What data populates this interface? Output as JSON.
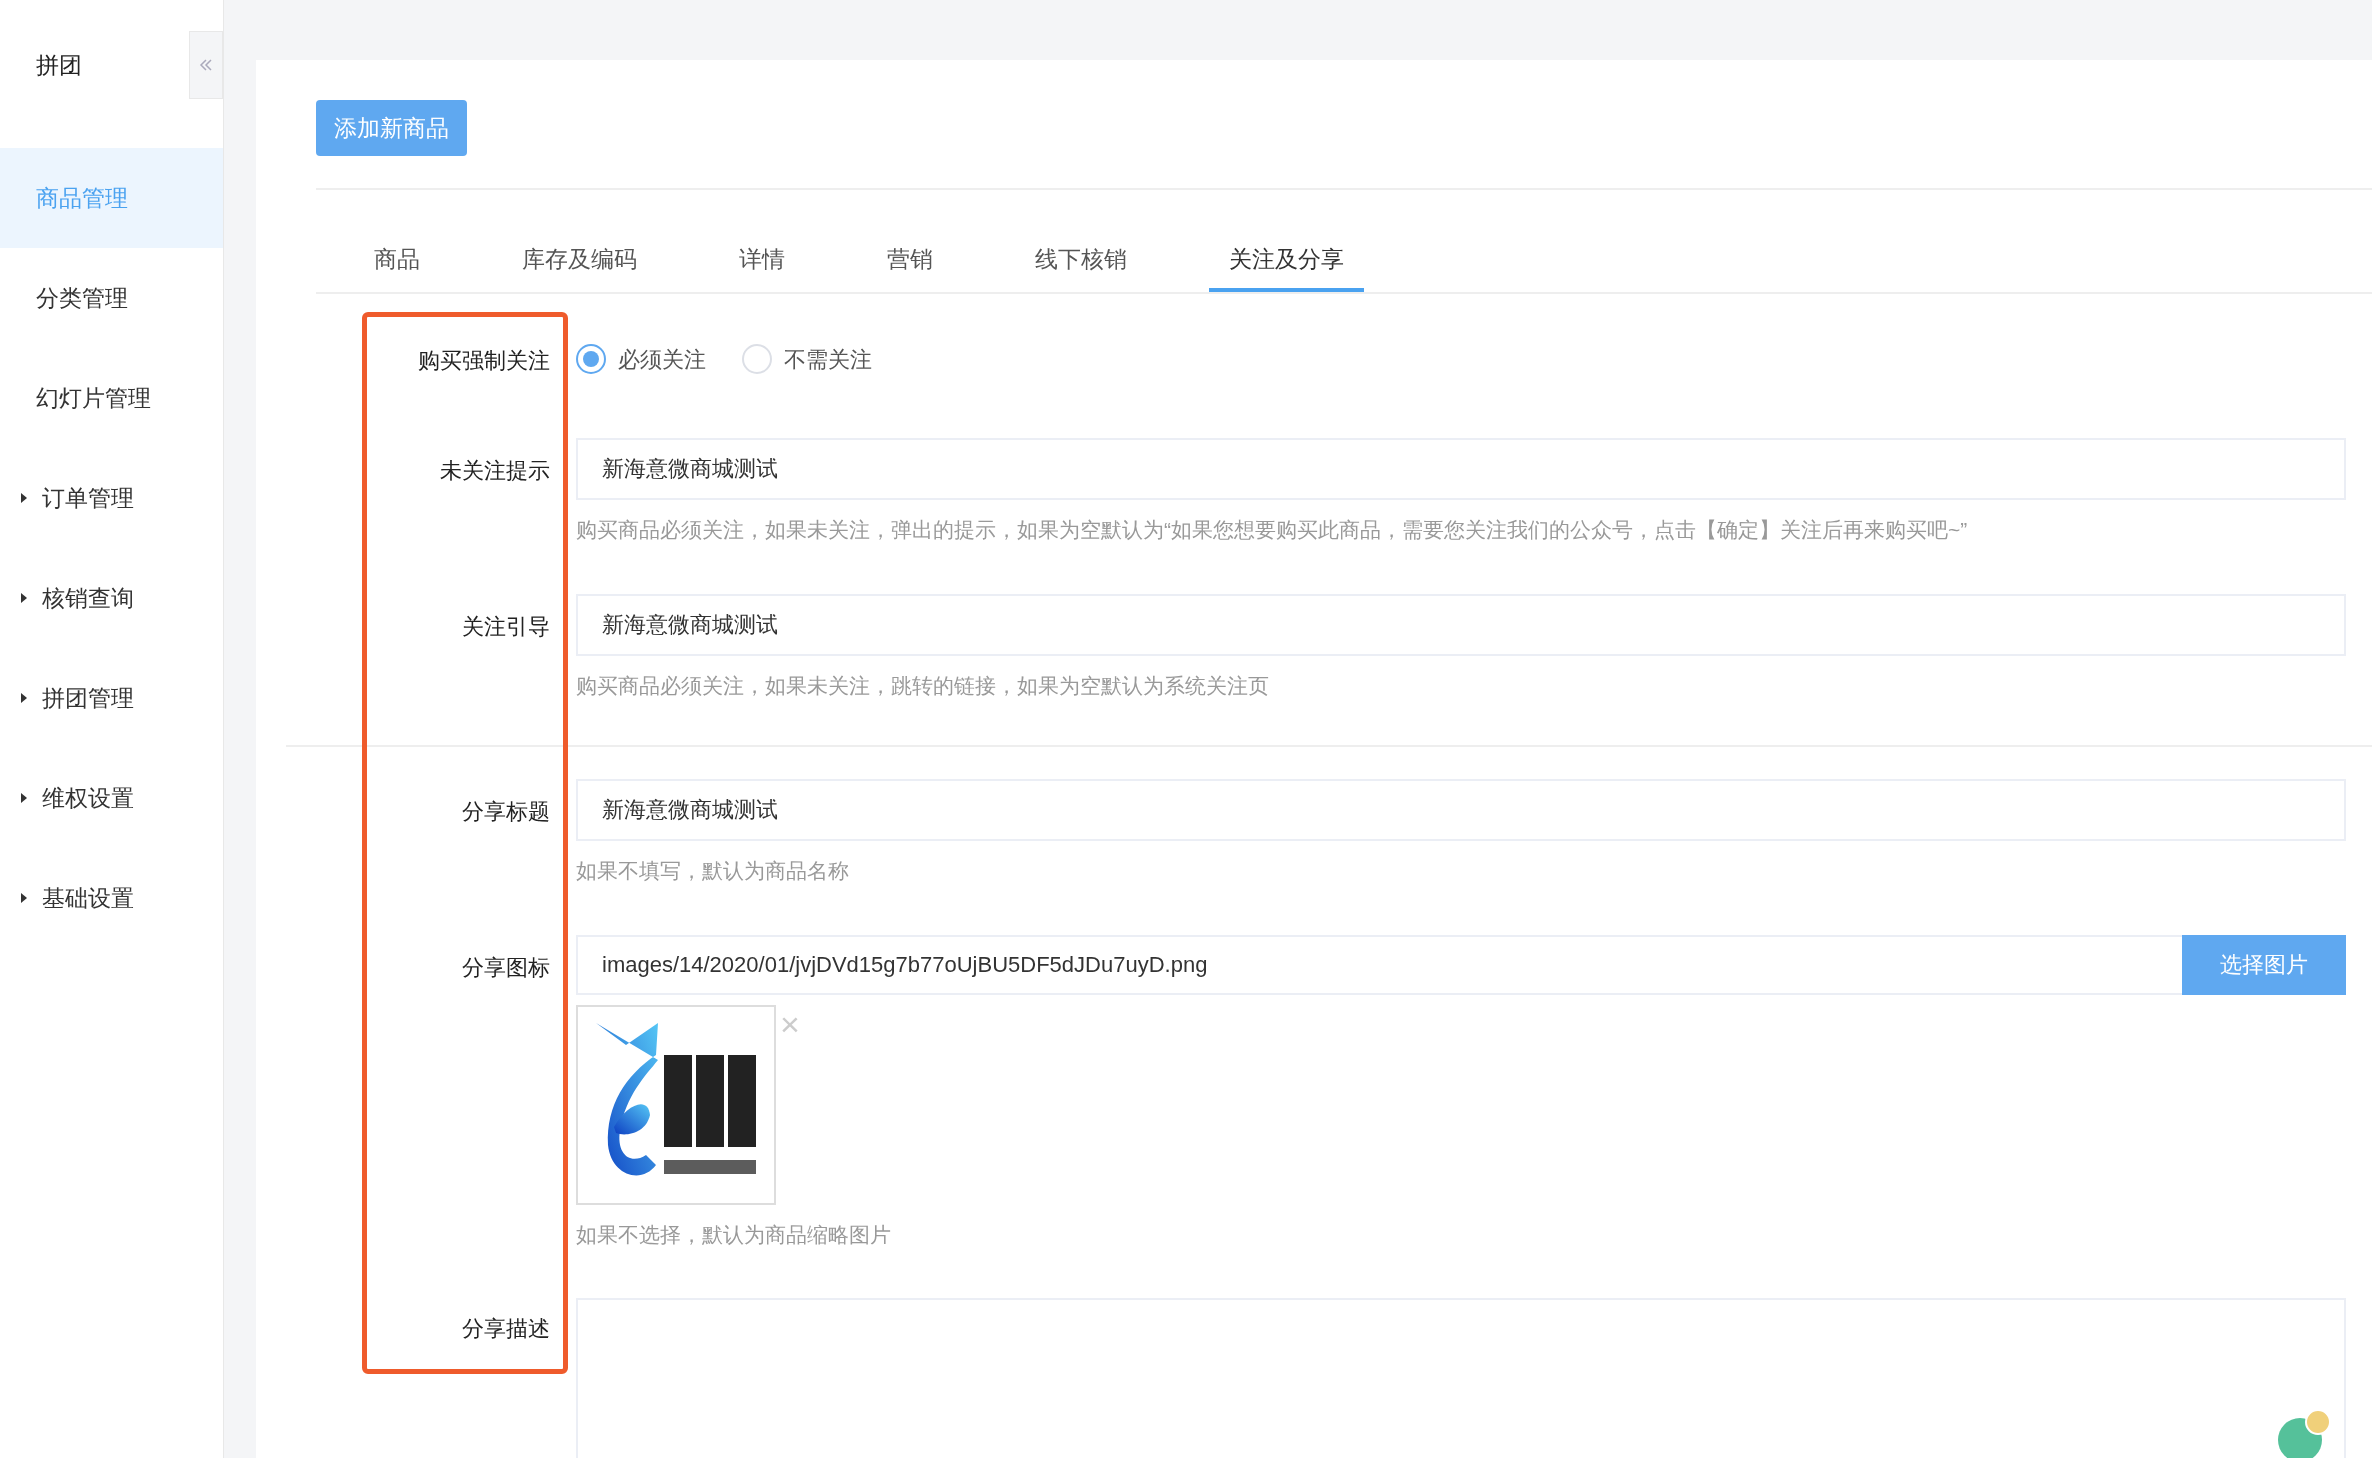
{
  "sidebar": {
    "title": "拼团",
    "items": [
      {
        "label": "商品管理",
        "selected": true,
        "has_children": false
      },
      {
        "label": "分类管理",
        "selected": false,
        "has_children": false
      },
      {
        "label": "幻灯片管理",
        "selected": false,
        "has_children": false
      },
      {
        "label": "订单管理",
        "selected": false,
        "has_children": true
      },
      {
        "label": "核销查询",
        "selected": false,
        "has_children": true
      },
      {
        "label": "拼团管理",
        "selected": false,
        "has_children": true
      },
      {
        "label": "维权设置",
        "selected": false,
        "has_children": true
      },
      {
        "label": "基础设置",
        "selected": false,
        "has_children": true
      }
    ]
  },
  "add_button": "添加新商品",
  "tabs": [
    {
      "label": "商品",
      "selected": false
    },
    {
      "label": "库存及编码",
      "selected": false
    },
    {
      "label": "详情",
      "selected": false
    },
    {
      "label": "营销",
      "selected": false
    },
    {
      "label": "线下核销",
      "selected": false
    },
    {
      "label": "关注及分享",
      "selected": true
    }
  ],
  "form": {
    "sections": [
      {
        "rows": [
          {
            "kind": "radio",
            "label": "购买强制关注",
            "options": [
              {
                "label": "必须关注",
                "selected": true
              },
              {
                "label": "不需关注",
                "selected": false
              }
            ]
          },
          {
            "kind": "input",
            "label": "未关注提示",
            "value": "新海意微商城测试",
            "help": "购买商品必须关注，如果未关注，弹出的提示，如果为空默认为“如果您想要购买此商品，需要您关注我们的公众号，点击【确定】关注后再来购买吧~”"
          },
          {
            "kind": "input",
            "label": "关注引导",
            "value": "新海意微商城测试",
            "help": "购买商品必须关注，如果未关注，跳转的链接，如果为空默认为系统关注页"
          }
        ]
      },
      {
        "rows": [
          {
            "kind": "input",
            "label": "分享标题",
            "value": "新海意微商城测试",
            "help": "如果不填写，默认为商品名称"
          },
          {
            "kind": "image",
            "label": "分享图标",
            "value": "images/14/2020/01/jvjDVd15g7b77oUjBU5DF5dJDu7uyD.png",
            "button": "选择图片",
            "remove": "×",
            "help": "如果不选择，默认为商品缩略图片"
          },
          {
            "kind": "textarea",
            "label": "分享描述"
          }
        ]
      }
    ]
  }
}
